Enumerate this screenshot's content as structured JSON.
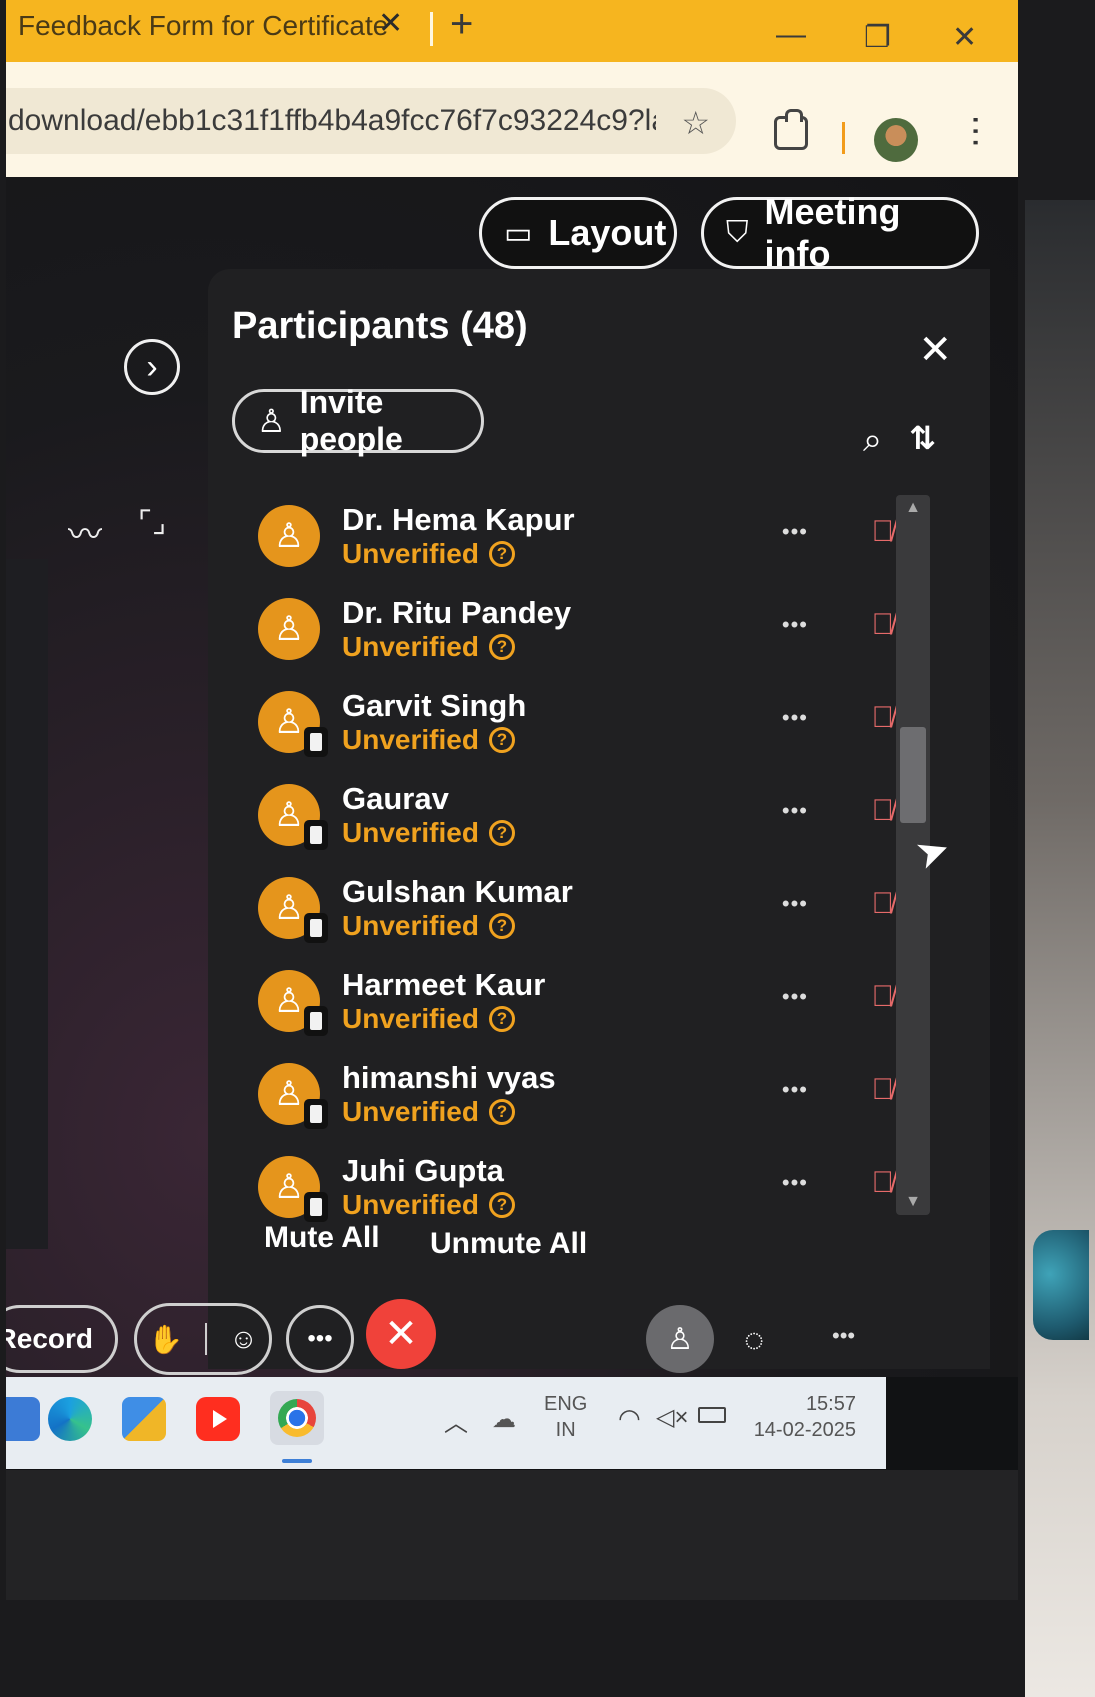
{
  "browser": {
    "tab_title": "Feedback Form for Certificate",
    "tab_close": "✕",
    "new_tab": "+",
    "url": "download/ebb1c31f1ffb4b4a9fcc76f7c93224c9?la..."
  },
  "meeting": {
    "layout_label": "Layout",
    "meeting_info_label": "Meeting info"
  },
  "participants_panel": {
    "title": "Participants (48)",
    "invite_label": "Invite people",
    "participants": [
      {
        "name": "Dr. Hema Kapur",
        "status": "Unverified",
        "device": "desktop"
      },
      {
        "name": "Dr. Ritu Pandey",
        "status": "Unverified",
        "device": "desktop"
      },
      {
        "name": "Garvit Singh",
        "status": "Unverified",
        "device": "mobile"
      },
      {
        "name": "Gaurav",
        "status": "Unverified",
        "device": "mobile"
      },
      {
        "name": "Gulshan Kumar",
        "status": "Unverified",
        "device": "mobile"
      },
      {
        "name": "Harmeet Kaur",
        "status": "Unverified",
        "device": "mobile"
      },
      {
        "name": "himanshi vyas",
        "status": "Unverified",
        "device": "mobile"
      },
      {
        "name": "Juhi Gupta",
        "status": "Unverified",
        "device": "mobile"
      }
    ],
    "mute_all_label": "Mute All",
    "unmute_all_label": "Unmute All"
  },
  "controls": {
    "record_label": "Record"
  },
  "taskbar": {
    "lang_primary": "ENG",
    "lang_secondary": "IN",
    "time": "15:57",
    "date": "14-02-2025"
  },
  "colors": {
    "tab_bar": "#f6b51f",
    "avatar": "#e5951c",
    "unverified": "#f0a21f",
    "mic_off": "#e66a6a",
    "leave": "#f0423a"
  }
}
